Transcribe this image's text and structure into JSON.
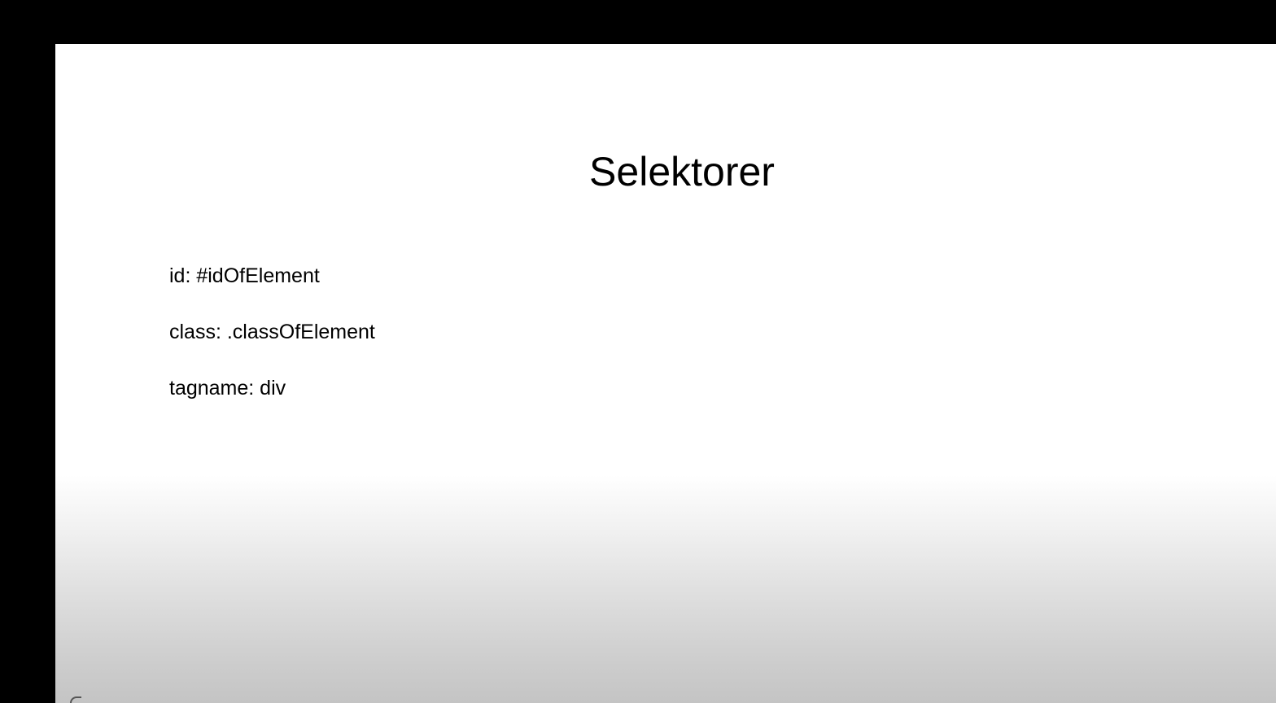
{
  "slide": {
    "title": "Selektorer",
    "lines": [
      "id: #idOfElement",
      "class: .classOfElement",
      "tagname: div"
    ]
  },
  "colors": {
    "background": "#000000",
    "slide": "#ffffff",
    "text": "#000000"
  }
}
